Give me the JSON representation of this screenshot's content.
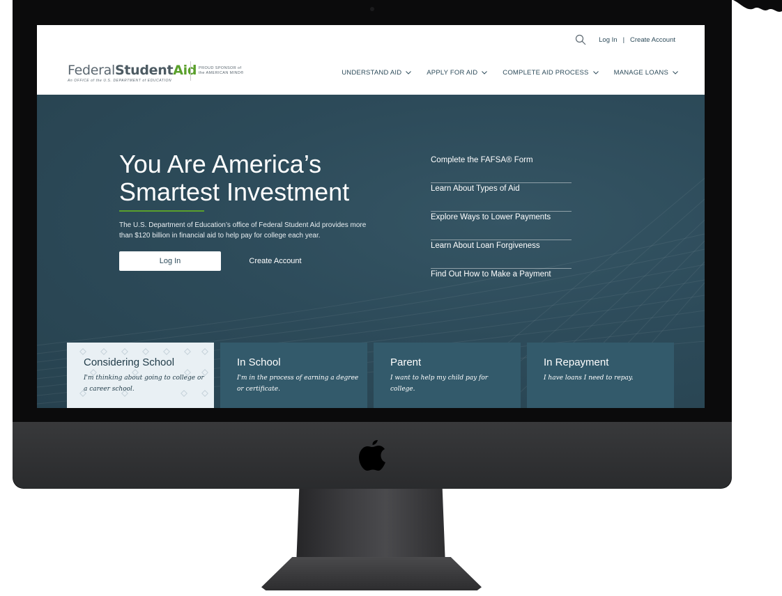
{
  "header": {
    "logo": {
      "word1": "Federal",
      "word2": "Student",
      "word3": "Aid",
      "subline": "An OFFICE of the U.S. DEPARTMENT of EDUCATION",
      "sponsor_line1": "PROUD SPONSOR of",
      "sponsor_line2": "the AMERICAN MIND®"
    },
    "utility": {
      "login_label": "Log In",
      "separator": "|",
      "create_account_label": "Create Account"
    },
    "nav": [
      {
        "label": "UNDERSTAND AID"
      },
      {
        "label": "APPLY FOR AID"
      },
      {
        "label": "COMPLETE AID PROCESS"
      },
      {
        "label": "MANAGE LOANS"
      }
    ]
  },
  "hero": {
    "title": "You Are America’s Smartest Investment",
    "description": "The U.S. Department of Education’s office of Federal Student Aid provides more than $120 billion in financial aid to help pay for college each year.",
    "login_button": "Log In",
    "create_account_button": "Create Account",
    "quick_links": [
      {
        "label": "Complete the FAFSA® Form"
      },
      {
        "label": "Learn About Types of Aid"
      },
      {
        "label": "Explore Ways to Lower Payments"
      },
      {
        "label": "Learn About Loan Forgiveness"
      },
      {
        "label": "Find Out How to Make a Payment"
      }
    ]
  },
  "audience_cards": [
    {
      "title": "Considering School",
      "description": "I'm thinking about going to college or a career school."
    },
    {
      "title": "In School",
      "description": "I'm in the process of earning a degree or certificate."
    },
    {
      "title": "Parent",
      "description": "I want to help my child pay for college."
    },
    {
      "title": "In Repayment",
      "description": "I have loans I need to repay."
    }
  ],
  "icons": {
    "search": "search-icon",
    "chevron": "chevron-down-icon",
    "apple": "apple-logo-icon"
  },
  "colors": {
    "primary": "#2d4b5a",
    "accent_green": "#5aa02c",
    "card_bg": "#335a6b",
    "card_active_bg": "#e9f0f4"
  }
}
